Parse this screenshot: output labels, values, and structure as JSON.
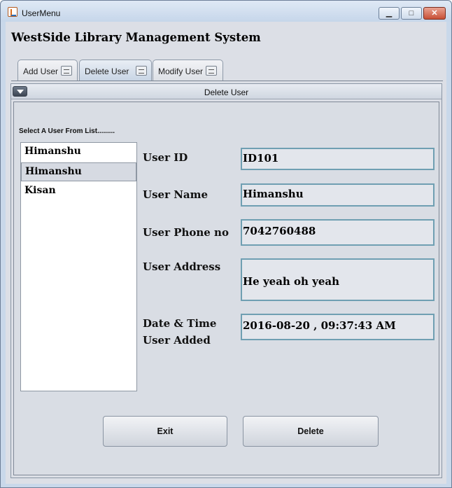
{
  "window": {
    "title": "UserMenu",
    "min": "▁",
    "max": "□",
    "close": "✕"
  },
  "app": {
    "heading": "WestSide Library Management System"
  },
  "tabs": [
    {
      "label": "Add User",
      "icon": "user-card-icon"
    },
    {
      "label": "Delete User",
      "icon": "user-card-icon"
    },
    {
      "label": "Modify User",
      "icon": "user-card-icon"
    }
  ],
  "panel": {
    "title": "Delete User"
  },
  "list": {
    "caption": "Select A User From List.........",
    "items": [
      "Himanshu",
      "Himanshu",
      "Kisan"
    ],
    "selected_index": 1
  },
  "fields": {
    "user_id": {
      "label": "User ID",
      "value": "ID101"
    },
    "user_name": {
      "label": "User Name",
      "value": "Himanshu"
    },
    "user_phone": {
      "label": "User Phone no",
      "value": "7042760488"
    },
    "user_address": {
      "label": "User Address",
      "value": "He yeah oh yeah"
    },
    "date_added": {
      "label_line1": "Date & Time",
      "label_line2": "User Added",
      "value": "2016-08-20 , 09:37:43 AM"
    }
  },
  "buttons": {
    "exit": "Exit",
    "delete": "Delete"
  },
  "colors": {
    "field_border": "#6f9fb2",
    "titlebar": "#c9d8ea"
  }
}
